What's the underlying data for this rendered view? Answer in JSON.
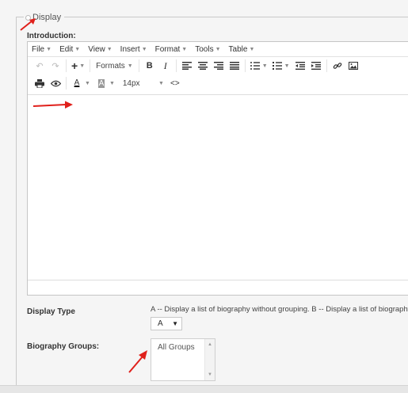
{
  "fieldset": {
    "legend": "Display"
  },
  "introduction": {
    "label": "Introduction:"
  },
  "menubar": [
    {
      "label": "File"
    },
    {
      "label": "Edit"
    },
    {
      "label": "View"
    },
    {
      "label": "Insert"
    },
    {
      "label": "Format"
    },
    {
      "label": "Tools"
    },
    {
      "label": "Table"
    }
  ],
  "toolbar": {
    "formats_label": "Formats",
    "bold": "B",
    "italic": "I",
    "font_size": "14px",
    "code": "<>",
    "text_color": "A",
    "bg_color": "A"
  },
  "display_type": {
    "label": "Display Type",
    "description": "A -- Display a list of biography without grouping. B -- Display a list of biography w",
    "selected": "A"
  },
  "biography_groups": {
    "label": "Biography Groups:",
    "options": [
      "All Groups"
    ]
  },
  "colors": {
    "arrow": "#e0201b",
    "border": "#c9c9c9"
  }
}
